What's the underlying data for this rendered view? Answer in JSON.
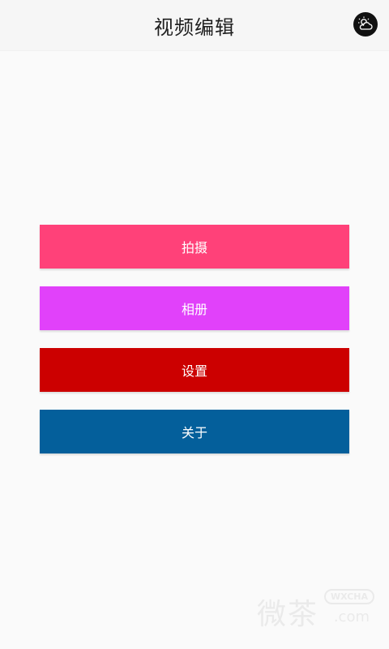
{
  "header": {
    "title": "视频编辑",
    "weather_icon": "cloud-sun-icon"
  },
  "menu": [
    {
      "label": "拍摄",
      "color": "#ff4179"
    },
    {
      "label": "相册",
      "color": "#e141fa"
    },
    {
      "label": "设置",
      "color": "#cc0000"
    },
    {
      "label": "关于",
      "color": "#045f9b"
    }
  ],
  "watermark": {
    "text": "微茶",
    "badge": "WXCHA",
    "domain": ".com"
  }
}
